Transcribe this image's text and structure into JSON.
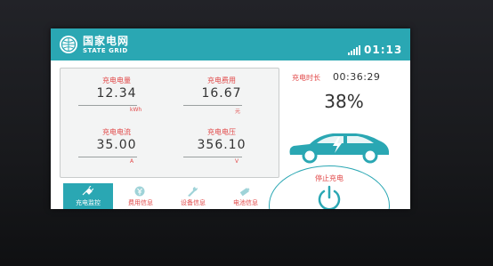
{
  "header": {
    "brand_cn": "国家电网",
    "brand_en": "STATE GRID",
    "time": "01:13"
  },
  "metrics": [
    {
      "label": "充电电量",
      "value": "12.34",
      "unit": "kWh"
    },
    {
      "label": "充电费用",
      "value": "16.67",
      "unit": "元"
    },
    {
      "label": "充电电流",
      "value": "35.00",
      "unit": "A"
    },
    {
      "label": "充电电压",
      "value": "356.10",
      "unit": "V"
    }
  ],
  "charge": {
    "duration_label": "充电时长",
    "duration": "00:36:29",
    "percent": "38%",
    "stop_label": "停止充电"
  },
  "tabs": [
    {
      "label": "充电监控",
      "icon": "plug-icon",
      "active": true
    },
    {
      "label": "费用信息",
      "icon": "yen-coin-icon",
      "active": false
    },
    {
      "label": "设备信息",
      "icon": "wrench-icon",
      "active": false
    },
    {
      "label": "电池信息",
      "icon": "battery-icon",
      "active": false
    }
  ],
  "colors": {
    "accent": "#2aa7b3",
    "label_red": "#e24a4a",
    "bezel": "#1c1d21"
  }
}
